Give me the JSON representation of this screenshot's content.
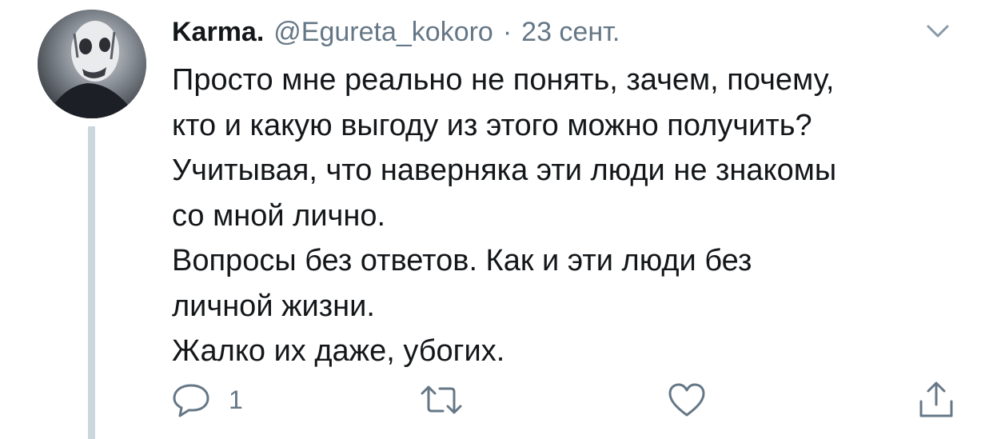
{
  "tweet": {
    "display_name": "Karma.",
    "handle": "@Egureta_kokoro",
    "separator": "·",
    "date": "23 сент.",
    "text_lines": [
      "Просто мне реально не понять, зачем, почему,",
      "кто и какую выгоду из этого можно получить?",
      "Учитывая, что наверняка эти люди не знакомы",
      "со мной лично.",
      "Вопросы без ответов. Как и эти люди без",
      "личной жизни.",
      "Жалко их даже, убогих."
    ],
    "reply_count": "1"
  },
  "icons": {
    "menu": "chevron-down-icon",
    "reply": "speech-bubble-icon",
    "retweet": "retweet-icon",
    "like": "heart-icon",
    "share": "share-icon"
  },
  "colors": {
    "text": "#14171a",
    "secondary": "#657786",
    "thread_line": "#ccd6dd"
  }
}
